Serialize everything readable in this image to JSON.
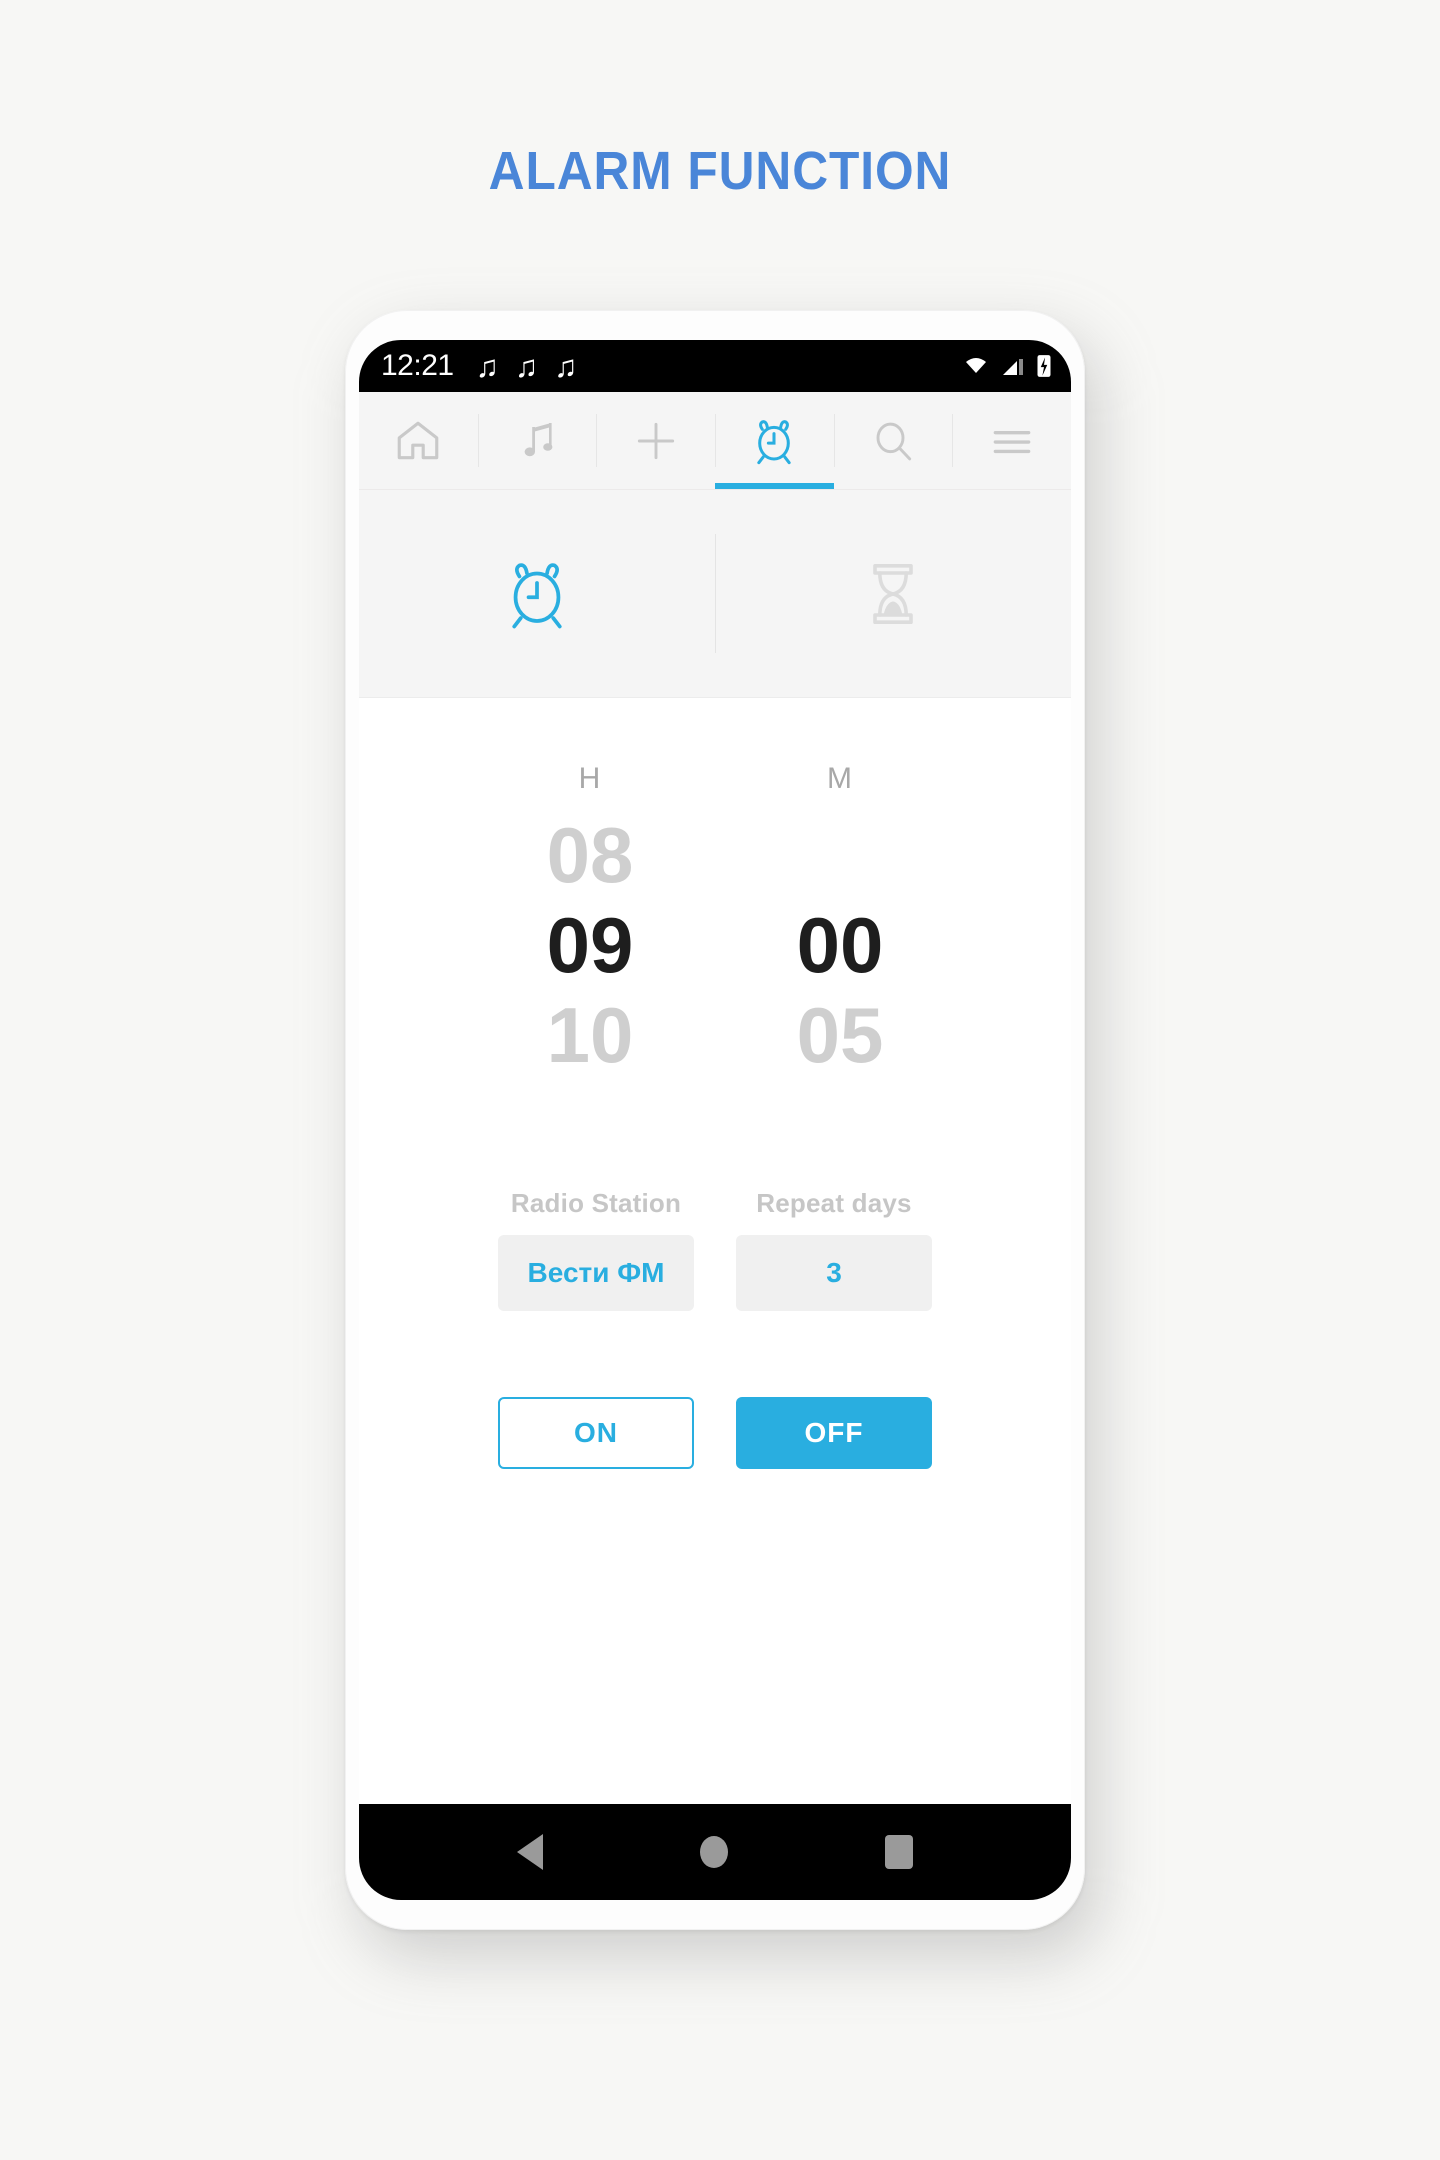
{
  "page": {
    "title": "ALARM FUNCTION",
    "title_color": "#4a86d8",
    "background": "#f7f7f5"
  },
  "accent_color": "#29aee0",
  "status_bar": {
    "time": "12:21",
    "notification_icons": [
      "music-note-icon",
      "music-note-icon",
      "music-note-icon"
    ],
    "note_glyph": "♫",
    "right_icons": [
      "wifi-icon",
      "cellular-signal-icon",
      "battery-charging-icon"
    ]
  },
  "top_nav": {
    "items": [
      {
        "name": "home",
        "icon": "home-icon",
        "active": false
      },
      {
        "name": "music",
        "icon": "music-note-icon",
        "active": false
      },
      {
        "name": "add",
        "icon": "plus-icon",
        "active": false
      },
      {
        "name": "alarm",
        "icon": "alarm-clock-icon",
        "active": true
      },
      {
        "name": "search",
        "icon": "search-icon",
        "active": false
      },
      {
        "name": "menu",
        "icon": "hamburger-menu-icon",
        "active": false
      }
    ]
  },
  "sub_tabs": [
    {
      "name": "alarm",
      "icon": "alarm-clock-icon",
      "active": true
    },
    {
      "name": "timer",
      "icon": "hourglass-icon",
      "active": false
    }
  ],
  "time_picker": {
    "hour_label": "H",
    "minute_label": "M",
    "hours": {
      "above": "08",
      "selected": "09",
      "below": "10"
    },
    "minutes": {
      "above": "",
      "selected": "00",
      "below": "05"
    }
  },
  "selectors": [
    {
      "label": "Radio Station",
      "value": "Вести ФМ"
    },
    {
      "label": "Repeat days",
      "value": "3"
    }
  ],
  "actions": {
    "on_label": "ON",
    "off_label": "OFF"
  },
  "android_nav": {
    "back": "back-triangle-icon",
    "home": "home-circle-icon",
    "recents": "recents-square-icon"
  }
}
